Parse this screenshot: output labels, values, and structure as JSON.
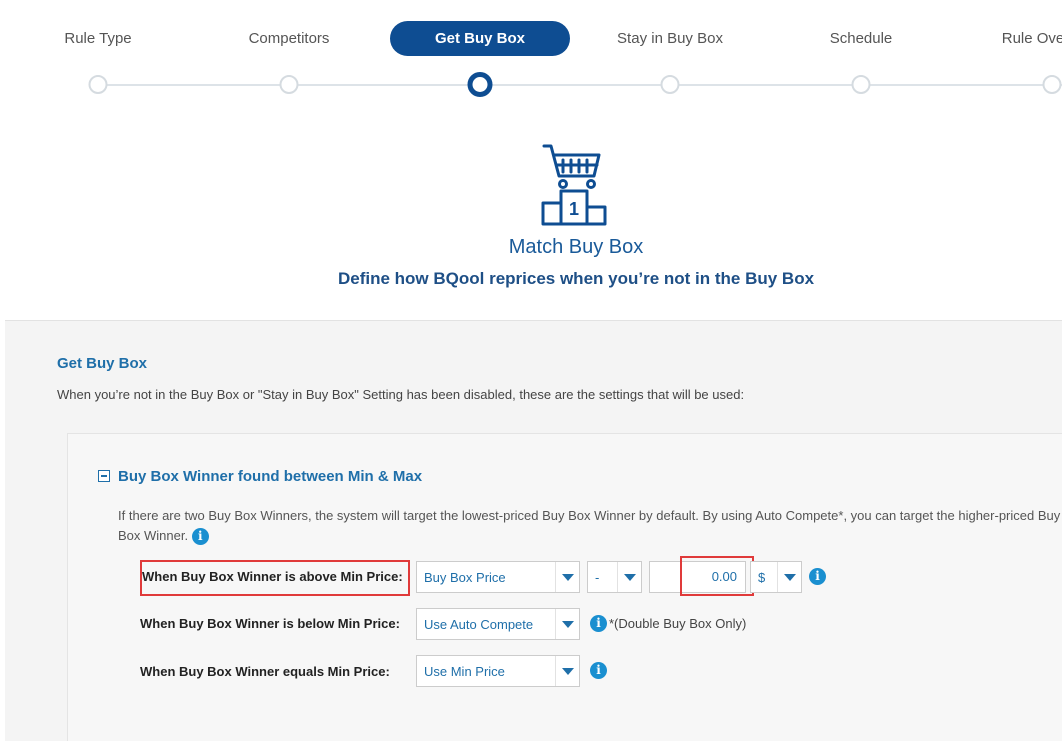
{
  "stepper": {
    "steps": [
      {
        "label": "Rule Type"
      },
      {
        "label": "Competitors"
      },
      {
        "label": "Get Buy Box"
      },
      {
        "label": "Stay in Buy Box"
      },
      {
        "label": "Schedule"
      },
      {
        "label": "Rule Ove"
      }
    ],
    "active_index": 2
  },
  "hero": {
    "icon": "cart-podium-icon",
    "title": "Match Buy Box",
    "subtitle": "Define how BQool reprices when you’re not in the Buy Box"
  },
  "panel": {
    "title": "Get Buy Box",
    "description": "When you’re not in the Buy Box or \"Stay in Buy Box\" Setting has been disabled, these are the settings that will be used:"
  },
  "section": {
    "title": "Buy Box Winner found between Min & Max",
    "description": "If there are two Buy Box Winners, the system will target the lowest-priced Buy Box Winner by default. By using Auto Compete*, you can target the higher-priced Buy Box Winner.",
    "rows": {
      "above": {
        "label": "When Buy Box Winner is above Min Price:",
        "price_select": "Buy Box Price",
        "operator_select": "-",
        "amount": "0.00",
        "unit_select": "$"
      },
      "below": {
        "label": "When Buy Box Winner is below Min Price:",
        "select": "Use Auto Compete",
        "note": "*(Double Buy Box Only)"
      },
      "equals": {
        "label": "When Buy Box Winner equals Min Price:",
        "select": "Use Min Price"
      }
    }
  },
  "colors": {
    "brand": "#0e4d92",
    "link": "#1f6fa9",
    "info": "#1a8fd0",
    "highlight": "#e03a3a"
  }
}
